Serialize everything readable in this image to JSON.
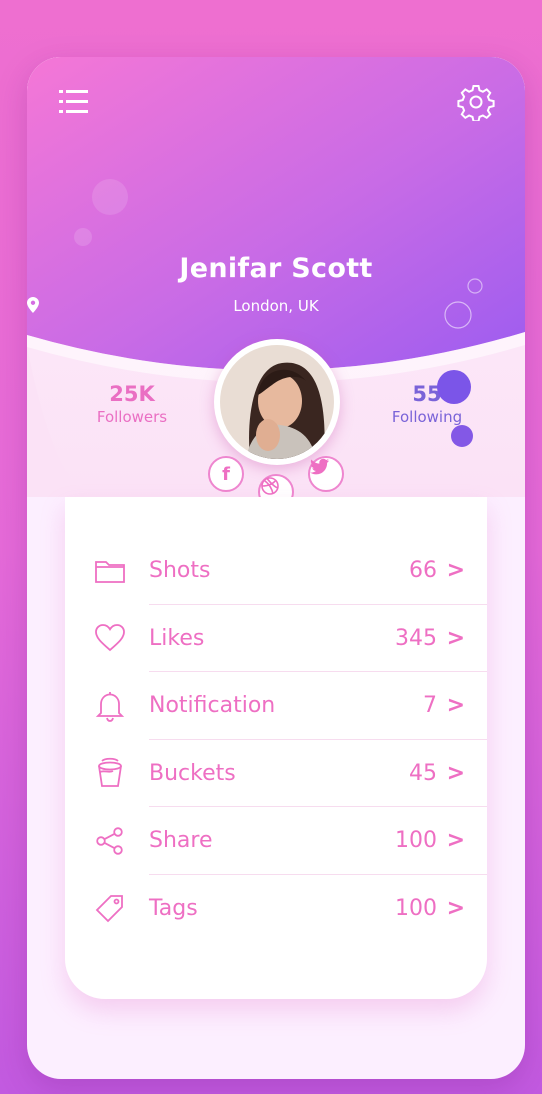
{
  "profile": {
    "name": "Jenifar Scott",
    "location": "London, UK"
  },
  "stats": {
    "followers": {
      "value": "25K",
      "label": "Followers"
    },
    "following": {
      "value": "55",
      "label": "Following"
    }
  },
  "social": {
    "facebook_glyph": "f",
    "dribbble_glyph": "◍",
    "twitter_glyph": "🐦"
  },
  "menu": [
    {
      "label": "Shots",
      "count": "66",
      "icon": "folder-icon"
    },
    {
      "label": "Likes",
      "count": "345",
      "icon": "heart-icon"
    },
    {
      "label": "Notification",
      "count": "7",
      "icon": "bell-icon"
    },
    {
      "label": "Buckets",
      "count": "45",
      "icon": "bucket-icon"
    },
    {
      "label": "Share",
      "count": "100",
      "icon": "share-icon"
    },
    {
      "label": "Tags",
      "count": "100",
      "icon": "tag-icon"
    }
  ],
  "arrow": ">",
  "colors": {
    "accent": "#ee6fc3",
    "header_start": "#f06fd0",
    "header_end": "#9a5cef",
    "following": "#7a63d8"
  }
}
